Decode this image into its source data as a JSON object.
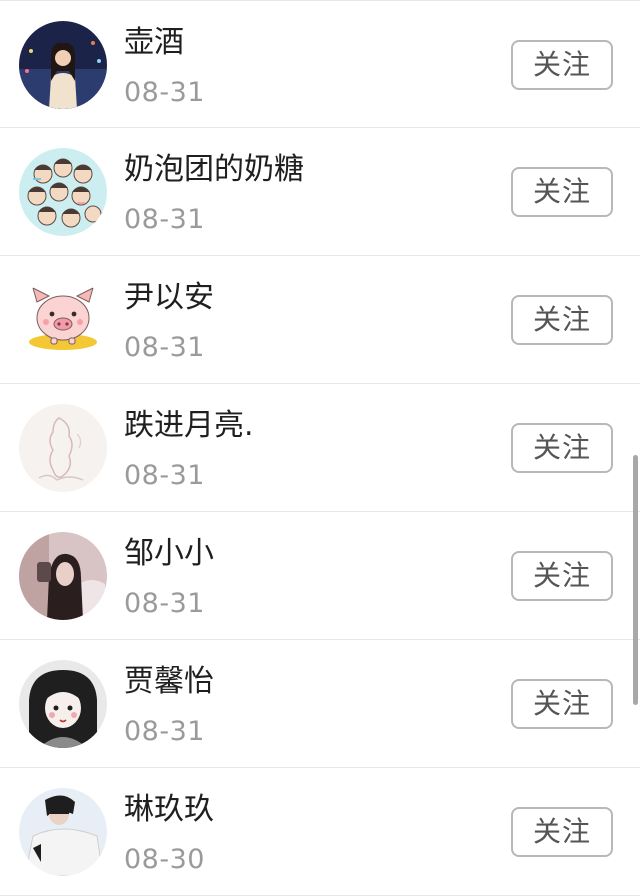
{
  "follow_label": "关注",
  "users": [
    {
      "name": "壶酒",
      "date": "08-31",
      "avatar_icon": "photo-girl-night-city"
    },
    {
      "name": "奶泡团的奶糖",
      "date": "08-31",
      "avatar_icon": "cartoon-group-faces"
    },
    {
      "name": "尹以安",
      "date": "08-31",
      "avatar_icon": "cartoon-pig"
    },
    {
      "name": "跌进月亮.",
      "date": "08-31",
      "avatar_icon": "sketch-drawing"
    },
    {
      "name": "邹小小",
      "date": "08-31",
      "avatar_icon": "photo-girl-blurred"
    },
    {
      "name": "贾馨怡",
      "date": "08-31",
      "avatar_icon": "anime-girl"
    },
    {
      "name": "琳玖玖",
      "date": "08-30",
      "avatar_icon": "photo-girl-outrage-shirt"
    }
  ],
  "colors": {
    "name": "#1f1f1f",
    "date": "#9a9a9a",
    "button_border": "#b8b8b8",
    "divider": "#e6e6e6"
  }
}
